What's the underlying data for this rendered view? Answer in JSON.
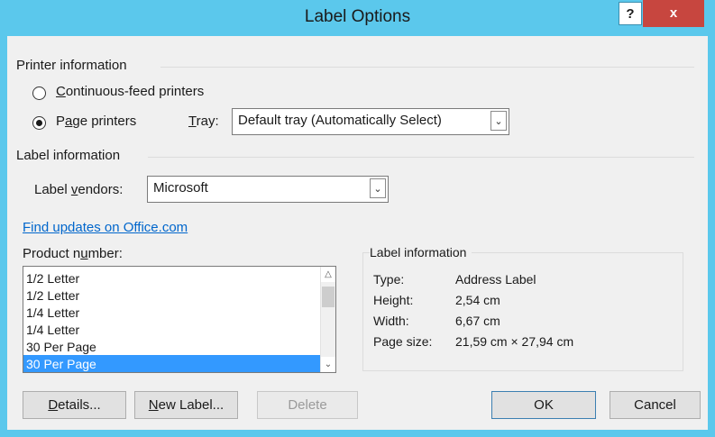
{
  "window": {
    "title": "Label Options",
    "help_glyph": "?",
    "close_glyph": "x"
  },
  "printer_info": {
    "heading": "Printer information",
    "continuous": {
      "prefix": "",
      "accel": "C",
      "rest": "ontinuous-feed printers",
      "checked": false
    },
    "page": {
      "prefix": "P",
      "accel": "a",
      "rest": "ge printers",
      "checked": true
    },
    "tray_label": {
      "prefix": "",
      "accel": "T",
      "rest": "ray:"
    },
    "tray_value": "Default tray (Automatically Select)"
  },
  "label_info": {
    "heading": "Label information",
    "vendors_label": {
      "prefix": "Label ",
      "accel": "v",
      "rest": "endors:"
    },
    "vendors_value": "Microsoft",
    "find_updates_link": "Find updates on Office.com"
  },
  "product": {
    "label": {
      "prefix": "Product n",
      "accel": "u",
      "rest": "mber:"
    },
    "items": [
      "1/2 Letter",
      "1/2 Letter",
      "1/4 Letter",
      "1/4 Letter",
      "30 Per Page",
      "30 Per Page"
    ],
    "selected_index": 5
  },
  "details": {
    "heading": "Label information",
    "rows": [
      {
        "key": "Type:",
        "value": "Address Label"
      },
      {
        "key": "Height:",
        "value": "2,54 cm"
      },
      {
        "key": "Width:",
        "value": "6,67 cm"
      },
      {
        "key": "Page size:",
        "value": "21,59 cm × 27,94 cm"
      }
    ]
  },
  "buttons": {
    "details": {
      "prefix": "",
      "accel": "D",
      "rest": "etails..."
    },
    "new_label": {
      "prefix": "",
      "accel": "N",
      "rest": "ew Label..."
    },
    "delete": "Delete",
    "ok": "OK",
    "cancel": "Cancel"
  },
  "icons": {
    "dropdown": "chevron-down-icon",
    "scroll_up": "arrow-up-icon",
    "scroll_down": "arrow-down-icon"
  },
  "colors": {
    "titlebar": "#5bc8ec",
    "close_button": "#c7463f",
    "selection": "#3399ff",
    "link": "#0066cc"
  }
}
